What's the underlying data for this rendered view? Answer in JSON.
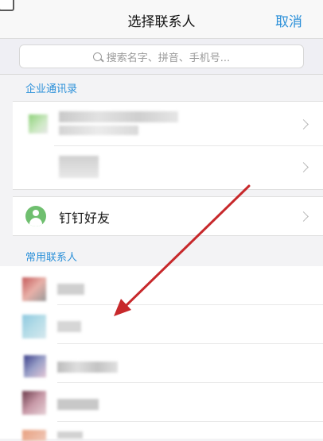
{
  "header": {
    "title": "选择联系人",
    "cancel_label": "取消"
  },
  "search": {
    "placeholder": "搜索名字、拼音、手机号..."
  },
  "sections": {
    "enterprise": "企业通讯录",
    "frequent": "常用联系人"
  },
  "friends": {
    "label": "钉钉好友"
  },
  "icons": [
    "app-corner-icon",
    "search-icon",
    "chevron-right-icon",
    "friend-avatar-icon"
  ],
  "colors": {
    "accent": "#2b90d9",
    "friend_icon": "#6fbf6f",
    "arrow": "#c7282b"
  }
}
